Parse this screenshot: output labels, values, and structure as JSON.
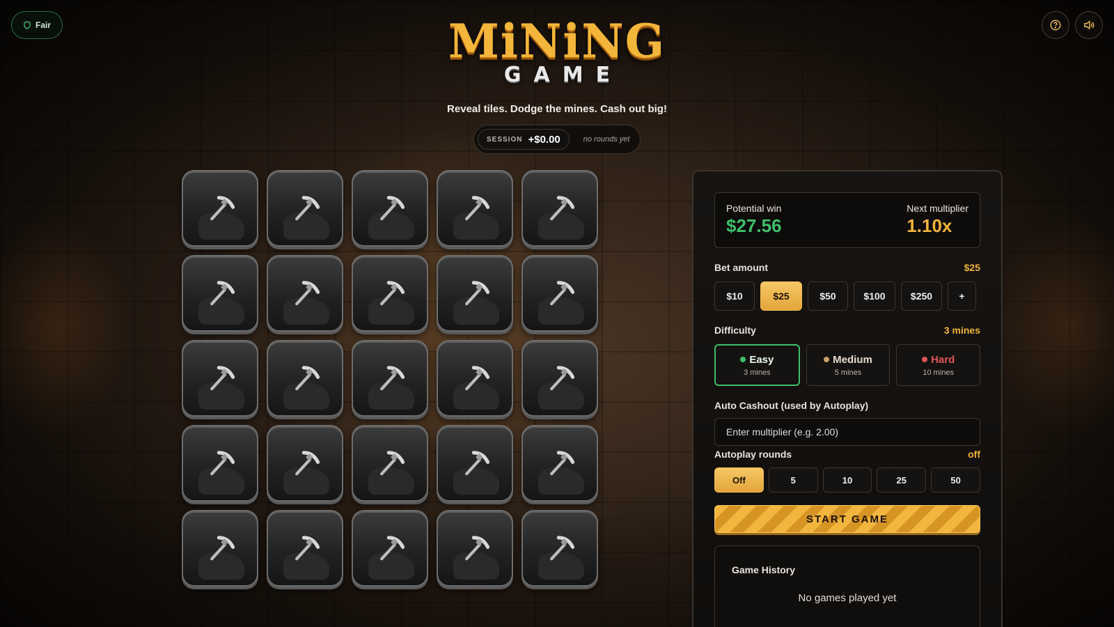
{
  "header": {
    "fair_label": "Fair",
    "logo_main": "MiNiNG",
    "logo_sub": "GAME",
    "tagline": "Reveal tiles. Dodge the mines. Cash out big!",
    "help_icon": "help-circle-icon",
    "sound_icon": "volume-icon"
  },
  "session": {
    "label": "SESSION",
    "value": "+$0.00",
    "rounds": "no rounds yet"
  },
  "grid": {
    "rows": 5,
    "cols": 5,
    "tile_icon": "pickaxe-icon"
  },
  "panel": {
    "potential_win_label": "Potential win",
    "potential_win_value": "$27.56",
    "next_multiplier_label": "Next multiplier",
    "next_multiplier_value": "1.10x",
    "bet": {
      "label": "Bet amount",
      "current": "$25",
      "options": [
        "$10",
        "$25",
        "$50",
        "$100",
        "$250",
        "+"
      ],
      "selected_index": 1
    },
    "difficulty": {
      "label": "Difficulty",
      "current": "3 mines",
      "options": [
        {
          "name": "Easy",
          "sub": "3 mines",
          "color": "#3fbf6a"
        },
        {
          "name": "Medium",
          "sub": "5 mines",
          "color": "#c9a36a"
        },
        {
          "name": "Hard",
          "sub": "10 mines",
          "color": "#e0555a"
        }
      ],
      "selected_index": 0
    },
    "auto_cashout": {
      "label": "Auto Cashout (used by Autoplay)",
      "placeholder": "Enter multiplier (e.g. 2.00)"
    },
    "autoplay": {
      "label": "Autoplay rounds",
      "current": "off",
      "options": [
        "Off",
        "5",
        "10",
        "25",
        "50"
      ],
      "selected_index": 0
    },
    "start_label": "START GAME",
    "history": {
      "title": "Game History",
      "empty": "No games played yet"
    }
  },
  "colors": {
    "accent_gold": "#f0b23a",
    "win_green": "#3fbf6a",
    "hard_red": "#e0555a"
  }
}
